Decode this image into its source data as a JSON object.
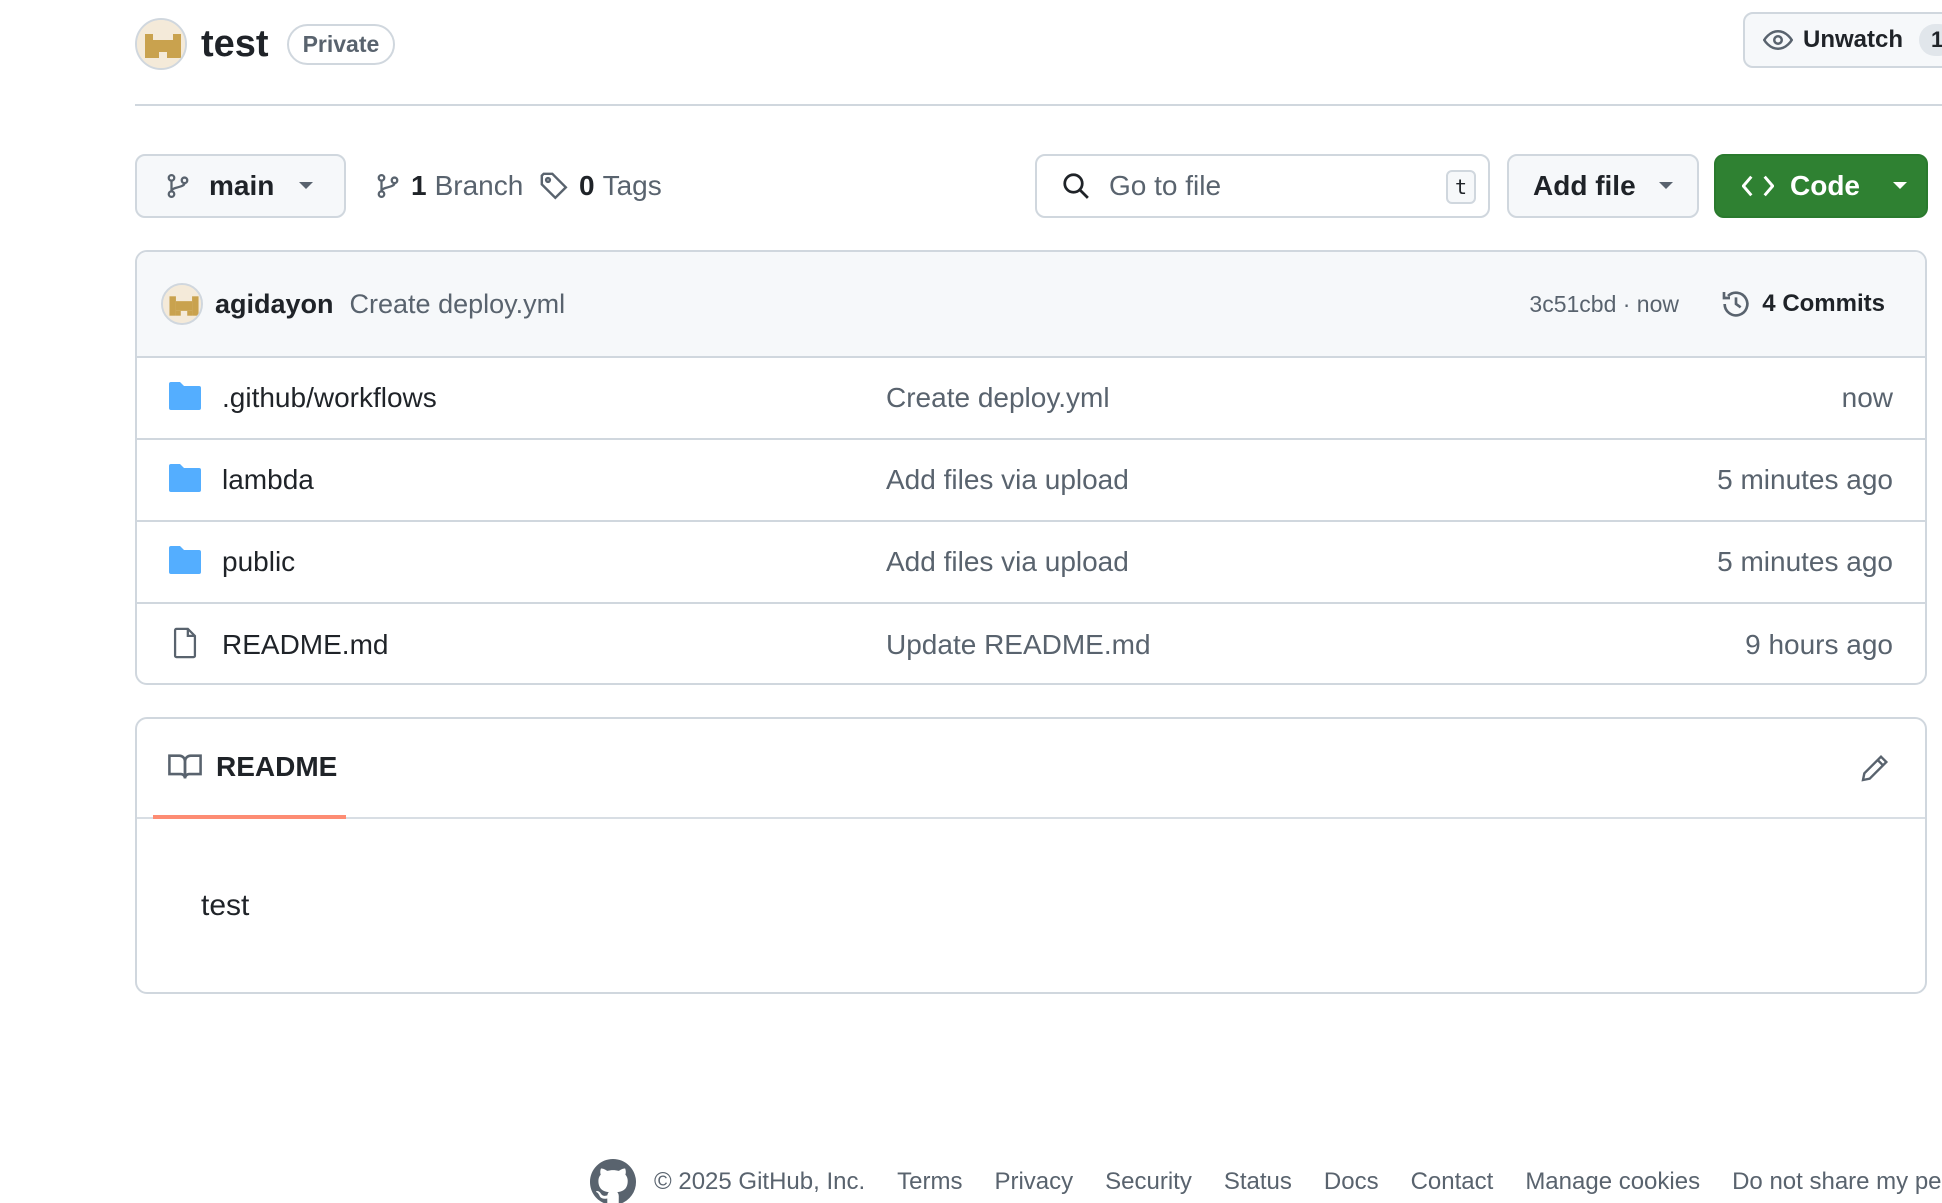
{
  "repo": {
    "name": "test",
    "visibility": "Private",
    "watch_label": "Unwatch",
    "watch_count": "1"
  },
  "toolbar": {
    "branch": "main",
    "branch_count": "1",
    "branch_label": "Branch",
    "tag_count": "0",
    "tag_label": "Tags",
    "search_placeholder": "Go to file",
    "search_shortcut": "t",
    "add_file_label": "Add file",
    "code_label": "Code"
  },
  "commit": {
    "author": "agidayon",
    "message": "Create deploy.yml",
    "meta": "3c51cbd · now",
    "commits_label": "4 Commits"
  },
  "files": [
    {
      "name": ".github/workflows",
      "type": "folder",
      "message": "Create deploy.yml",
      "time": "now"
    },
    {
      "name": "lambda",
      "type": "folder",
      "message": "Add files via upload",
      "time": "5 minutes ago"
    },
    {
      "name": "public",
      "type": "folder",
      "message": "Add files via upload",
      "time": "5 minutes ago"
    },
    {
      "name": "README.md",
      "type": "file",
      "message": "Update README.md",
      "time": "9 hours ago"
    }
  ],
  "readme": {
    "tab_label": "README",
    "content": "test"
  },
  "footer": {
    "copyright": "© 2025 GitHub, Inc.",
    "links": [
      "Terms",
      "Privacy",
      "Security",
      "Status",
      "Docs",
      "Contact",
      "Manage cookies",
      "Do not share my perso"
    ]
  },
  "colors": {
    "accent_green": "#2f8132",
    "folder_blue": "#54aeff",
    "tab_underline": "#fd8c73",
    "border": "#d0d7de"
  },
  "icons": {
    "branch": "git-branch-icon",
    "tag": "tag-icon",
    "search": "search-icon",
    "code": "code-icon",
    "history": "history-icon",
    "folder": "folder-icon",
    "file": "file-icon",
    "book": "book-icon",
    "pencil": "pencil-icon",
    "eye": "eye-icon",
    "github": "github-mark-icon"
  }
}
